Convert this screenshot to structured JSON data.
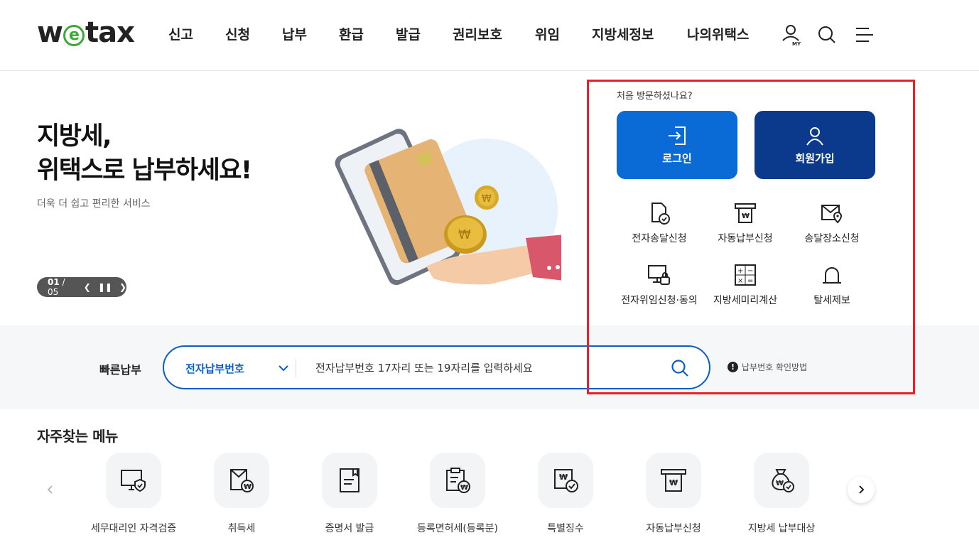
{
  "header": {
    "logo": "wetax",
    "nav": [
      "신고",
      "신청",
      "납부",
      "환급",
      "발급",
      "권리보호",
      "위임",
      "지방세정보",
      "나의위택스"
    ],
    "my_label": "MY"
  },
  "hero": {
    "title_line1": "지방세,",
    "title_line2": "위택스로 납부하세요!",
    "subtitle": "더욱 더 쉽고 편리한 서비스",
    "pager_current": "01",
    "pager_total": "/ 05"
  },
  "panel": {
    "first_visit": "처음 방문하셨나요?",
    "login": "로그인",
    "join": "회원가입",
    "quick_items": [
      {
        "label": "전자송달신청",
        "icon": "document-check-icon"
      },
      {
        "label": "자동납부신청",
        "icon": "auto-pay-icon"
      },
      {
        "label": "송달장소신청",
        "icon": "mail-location-icon"
      },
      {
        "label": "전자위임신청·동의",
        "icon": "monitor-lock-icon"
      },
      {
        "label": "지방세미리계산",
        "icon": "calculator-icon"
      },
      {
        "label": "탈세제보",
        "icon": "alarm-bell-icon"
      }
    ]
  },
  "quick_pay": {
    "label": "빠른납부",
    "select_value": "전자납부번호",
    "placeholder": "전자납부번호 17자리 또는 19자리를 입력하세요",
    "howto": "납부번호 확인방법"
  },
  "frequent": {
    "title": "자주찾는 메뉴",
    "items": [
      {
        "label": "세무대리인 자격검증",
        "icon": "monitor-shield-icon"
      },
      {
        "label": "취득세",
        "icon": "building-won-icon"
      },
      {
        "label": "증명서 발급",
        "icon": "certificate-icon"
      },
      {
        "label": "등록면허세(등록분)",
        "icon": "clipboard-won-icon"
      },
      {
        "label": "특별징수",
        "icon": "won-doc-check-icon"
      },
      {
        "label": "자동납부신청",
        "icon": "auto-pay-icon"
      },
      {
        "label": "지방세 납부대상",
        "icon": "money-bag-icon"
      }
    ]
  },
  "colors": {
    "accent_blue": "#0a6ad6",
    "navy": "#0b3a8c",
    "highlight_red": "#e8202a",
    "logo_green": "#3aa935"
  }
}
